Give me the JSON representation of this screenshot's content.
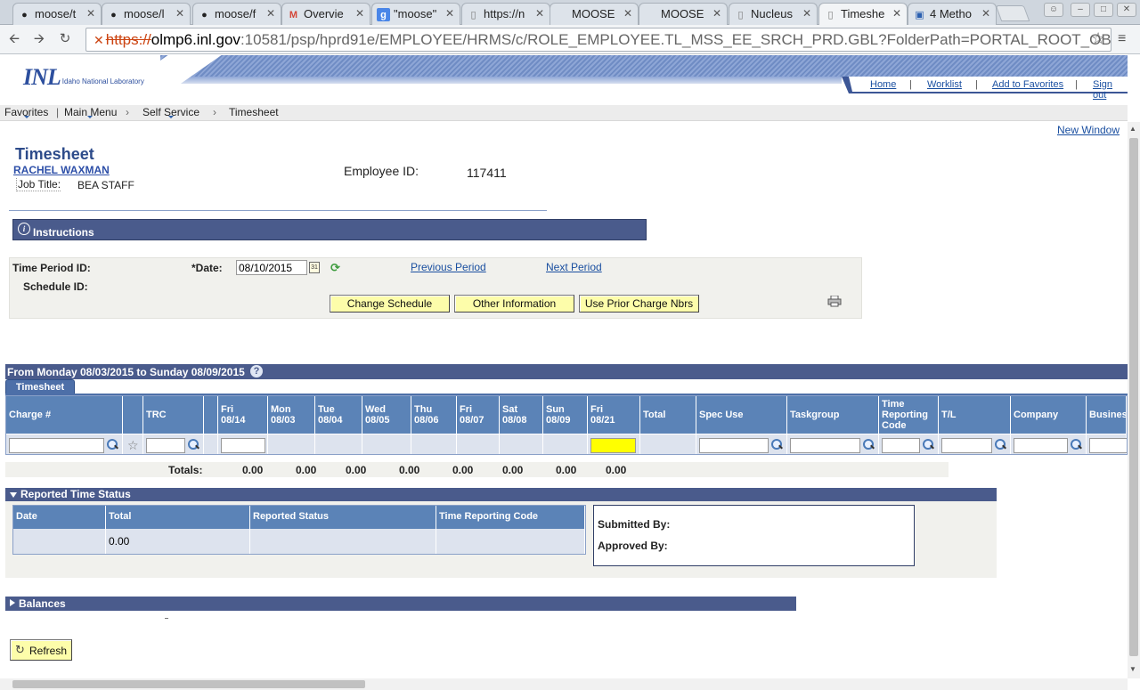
{
  "browser": {
    "tabs": [
      {
        "title": "moose/t",
        "icon": "github-icon",
        "active": false
      },
      {
        "title": "moose/l",
        "icon": "github-icon",
        "active": false
      },
      {
        "title": "moose/f",
        "icon": "github-icon",
        "active": false
      },
      {
        "title": "Overvie",
        "icon": "gmail-icon",
        "active": false
      },
      {
        "title": "\"moose\"",
        "icon": "google-icon",
        "active": false
      },
      {
        "title": "https://n",
        "icon": "page-icon",
        "active": false
      },
      {
        "title": "MOOSE",
        "icon": "none",
        "active": false
      },
      {
        "title": "MOOSE",
        "icon": "none",
        "active": false
      },
      {
        "title": "Nucleus",
        "icon": "page-icon",
        "active": false
      },
      {
        "title": "Timeshe",
        "icon": "page-icon",
        "active": true
      },
      {
        "title": "4 Metho",
        "icon": "blue-square-icon",
        "active": false
      }
    ],
    "url_scheme": "https://",
    "url_host": "olmp6.inl.gov",
    "url_rest": ":10581/psp/hprd91e/EMPLOYEE/HRMS/c/ROLE_EMPLOYEE.TL_MSS_EE_SRCH_PRD.GBL?FolderPath=PORTAL_ROOT_OBJECT.CO"
  },
  "header": {
    "logo_text": "INL",
    "logo_subtext": "Idaho National Laboratory",
    "links": [
      "Home",
      "Worklist",
      "Add to Favorites",
      "Sign out"
    ],
    "brand_color": "#4a5b8c"
  },
  "breadcrumb": {
    "items": [
      "Favorites",
      "Main Menu",
      "Self Service",
      "Timesheet"
    ]
  },
  "new_window": "New Window",
  "page_title": "Timesheet",
  "employee": {
    "name": "RACHEL WAXMAN",
    "job_title_label": "Job Title:",
    "job_title": "BEA STAFF",
    "id_label": "Employee ID:",
    "id_value": "117411"
  },
  "instructions_label": "Instructions",
  "period": {
    "time_period_label": "Time Period ID:",
    "schedule_label": "Schedule ID:",
    "date_label": "*Date:",
    "date_value": "08/10/2015",
    "previous": "Previous Period",
    "next": "Next Period",
    "buttons": [
      "Change Schedule",
      "Other Information",
      "Use Prior Charge Nbrs"
    ]
  },
  "range": {
    "label": "From Monday 08/03/2015 to Sunday 08/09/2015",
    "help": "?",
    "tab": "Timesheet"
  },
  "grid": {
    "columns": [
      {
        "l1": "Charge #",
        "l2": "",
        "l3": ""
      },
      {
        "l1": "",
        "l2": "",
        "l3": ""
      },
      {
        "l1": "TRC",
        "l2": "",
        "l3": ""
      },
      {
        "l1": "",
        "l2": "",
        "l3": ""
      },
      {
        "l1": "Fri",
        "l2": "08/14",
        "l3": ""
      },
      {
        "l1": "Mon",
        "l2": "08/03",
        "l3": ""
      },
      {
        "l1": "Tue",
        "l2": "08/04",
        "l3": ""
      },
      {
        "l1": "Wed",
        "l2": "08/05",
        "l3": ""
      },
      {
        "l1": "Thu",
        "l2": "08/06",
        "l3": ""
      },
      {
        "l1": "Fri",
        "l2": "08/07",
        "l3": ""
      },
      {
        "l1": "Sat",
        "l2": "08/08",
        "l3": ""
      },
      {
        "l1": "Sun",
        "l2": "08/09",
        "l3": ""
      },
      {
        "l1": "Fri",
        "l2": "08/21",
        "l3": ""
      },
      {
        "l1": "Total",
        "l2": "",
        "l3": ""
      },
      {
        "l1": "Spec Use",
        "l2": "",
        "l3": ""
      },
      {
        "l1": "Taskgroup",
        "l2": "",
        "l3": ""
      },
      {
        "l1": "Time",
        "l2": "Reporting",
        "l3": "Code"
      },
      {
        "l1": "T/L",
        "l2": "",
        "l3": ""
      },
      {
        "l1": "Company",
        "l2": "",
        "l3": ""
      },
      {
        "l1": "Business",
        "l2": "",
        "l3": ""
      }
    ],
    "highlight_color": "#ffff00"
  },
  "totals": {
    "label": "Totals:",
    "values": [
      "0.00",
      "0.00",
      "0.00",
      "0.00",
      "0.00",
      "0.00",
      "0.00",
      "0.00"
    ]
  },
  "reported": {
    "title": "Reported Time Status",
    "headers": [
      "Date",
      "Total",
      "Reported Status",
      "Time Reporting Code"
    ],
    "row": [
      "",
      "0.00",
      "",
      ""
    ],
    "submitted_by": "Submitted By:",
    "approved_by": "Approved By:"
  },
  "balances_label": "Balances",
  "refresh_label": "Refresh"
}
